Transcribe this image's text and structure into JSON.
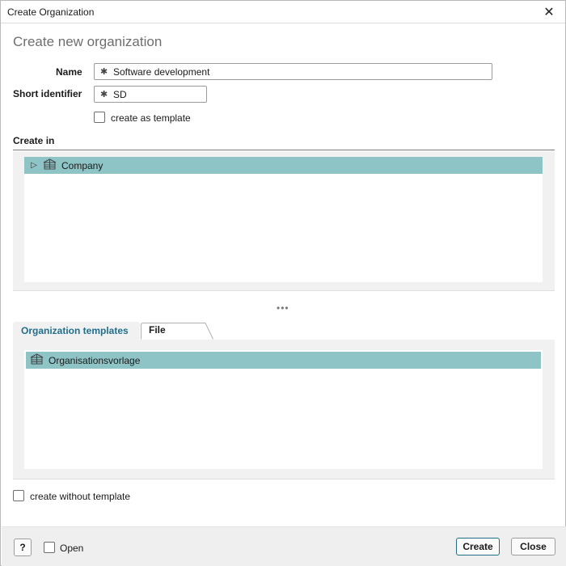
{
  "window": {
    "title": "Create Organization",
    "close_icon": "close-icon",
    "close_glyph": "✕"
  },
  "heading": "Create new organization",
  "form": {
    "name_label": "Name",
    "name_value": "Software development",
    "short_label": "Short identifier",
    "short_value": "SD",
    "required_marker": "✱",
    "template_checkbox_label": "create as template"
  },
  "create_in": {
    "label": "Create in",
    "tree": [
      {
        "label": "Company",
        "icon": "building-icon",
        "expander": "▷"
      }
    ]
  },
  "splitter": "•••",
  "tabs": [
    {
      "label": "Organization templates",
      "active": true
    },
    {
      "label": "File",
      "active": false
    }
  ],
  "templates": {
    "items": [
      {
        "label": "Organisationsvorlage",
        "icon": "building-icon"
      }
    ],
    "without_template_label": "create without template"
  },
  "footer": {
    "help_label": "?",
    "open_label": "Open",
    "create_label": "Create",
    "close_label": "Close"
  },
  "colors": {
    "selection": "#8ec4c6",
    "accent": "#1f6e8c",
    "panel": "#f1f1f1"
  }
}
